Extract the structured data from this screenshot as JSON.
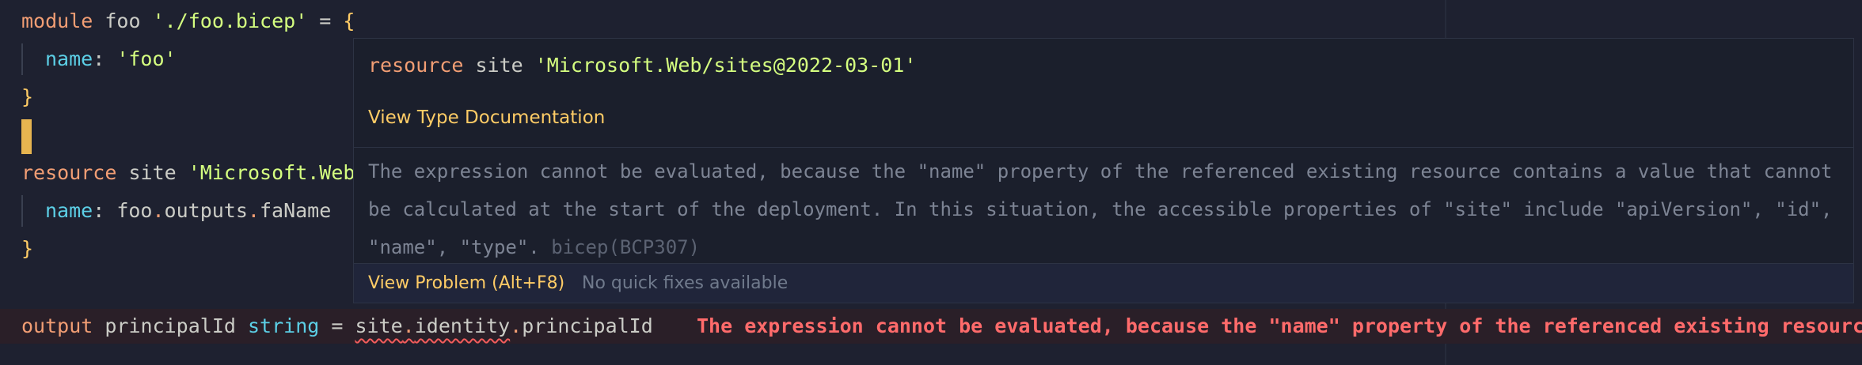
{
  "editor": {
    "line1": {
      "kw": "module",
      "name": " foo ",
      "path": "'./foo.bicep'",
      "eq": " = ",
      "brace": "{"
    },
    "line2": {
      "prop": "name",
      "colon": ": ",
      "value": "'foo'"
    },
    "line3": {
      "brace": "}"
    },
    "line5": {
      "kw": "resource",
      "name": " site ",
      "type": "'Microsoft.Web"
    },
    "line6": {
      "prop": "name",
      "colon": ": ",
      "obj": "foo",
      "dot1": ".",
      "member1": "outputs",
      "dot2": ".",
      "member2": "faName"
    },
    "line7": {
      "brace": "}"
    },
    "line9": {
      "kw": "output",
      "name": " principalId ",
      "type": "string",
      "eq": " = ",
      "ref1": "site",
      "dot1": ".",
      "ref2": "identity",
      "dot2": ".",
      "ref3": "principalId"
    },
    "inline_error": "The expression cannot be evaluated, because the \"name\" property of the referenced existing resourc"
  },
  "hover": {
    "signature": {
      "kw": "resource",
      "name": " site ",
      "type": "'Microsoft.Web/sites@2022-03-01'"
    },
    "doc_link": "View Type Documentation",
    "message": "The expression cannot be evaluated, because the \"name\" property of the referenced existing resource contains a value that cannot be calculated at the start of the deployment. In this situation, the accessible properties of \"site\" include \"apiVersion\", \"id\", \"name\", \"type\".",
    "source": "bicep(BCP307)",
    "view_problem": "View Problem (Alt+F8)",
    "no_fixes": "No quick fixes available"
  },
  "colors": {
    "background": "#1e2130",
    "keyword": "#f29e74",
    "string": "#d5ff80",
    "property": "#5ccfe6",
    "brace": "#ffcc66",
    "error": "#ff6b6b",
    "cursor": "#e6b450"
  }
}
